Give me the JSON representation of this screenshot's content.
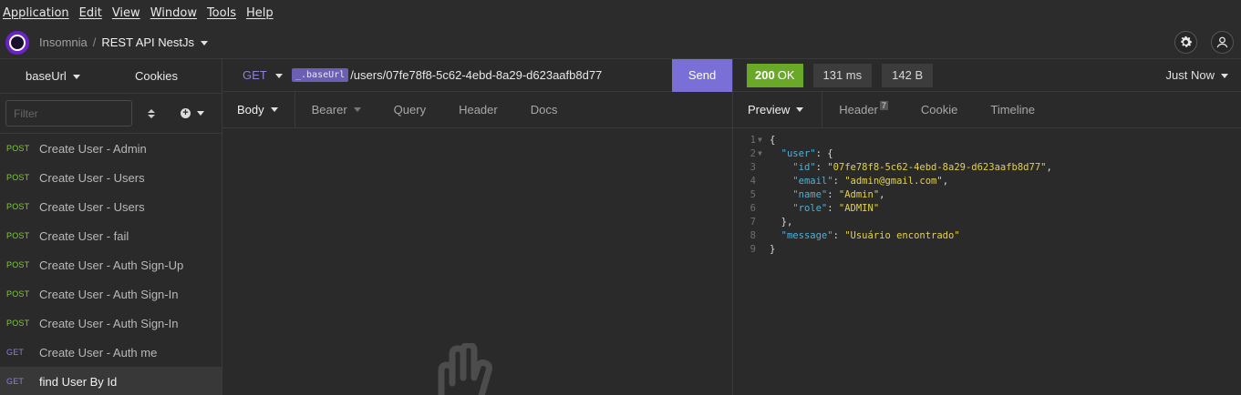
{
  "menu": [
    "Application",
    "Edit",
    "View",
    "Window",
    "Tools",
    "Help"
  ],
  "title": {
    "app": "Insomnia",
    "separator": "/",
    "project": "REST API NestJs"
  },
  "sidebar": {
    "environment": "baseUrl",
    "cookies": "Cookies",
    "filter_placeholder": "Filter",
    "requests": [
      {
        "method": "POST",
        "name": "Create User - Admin"
      },
      {
        "method": "POST",
        "name": "Create User - Users"
      },
      {
        "method": "POST",
        "name": "Create User - Users"
      },
      {
        "method": "POST",
        "name": "Create User - fail"
      },
      {
        "method": "POST",
        "name": "Create User - Auth Sign-Up"
      },
      {
        "method": "POST",
        "name": "Create User - Auth Sign-In"
      },
      {
        "method": "POST",
        "name": "Create User - Auth Sign-In"
      },
      {
        "method": "GET",
        "name": "Create User - Auth me"
      },
      {
        "method": "GET",
        "name": "find User By Id",
        "active": true
      }
    ]
  },
  "request": {
    "method": "GET",
    "url_variable": "_.baseUrl",
    "url_path": "/users/07fe78f8-5c62-4ebd-8a29-d623aafb8d77",
    "send_label": "Send",
    "tabs": [
      "Body",
      "Bearer",
      "Query",
      "Header",
      "Docs"
    ]
  },
  "response": {
    "status_code": "200",
    "status_text": "OK",
    "time": "131 ms",
    "size": "142 B",
    "history": "Just Now",
    "tabs": [
      "Preview",
      "Header",
      "Cookie",
      "Timeline"
    ],
    "header_count": "7",
    "lines": [
      {
        "n": "1",
        "fold": "▼",
        "text": "{"
      },
      {
        "n": "2",
        "fold": "▼",
        "indent": 1,
        "key": "\"user\"",
        "rest": ": {"
      },
      {
        "n": "3",
        "indent": 2,
        "key": "\"id\"",
        "value": "\"07fe78f8-5c62-4ebd-8a29-d623aafb8d77\"",
        "tail": ","
      },
      {
        "n": "4",
        "indent": 2,
        "key": "\"email\"",
        "value": "\"admin@gmail.com\"",
        "tail": ","
      },
      {
        "n": "5",
        "indent": 2,
        "key": "\"name\"",
        "value": "\"Admin\"",
        "tail": ","
      },
      {
        "n": "6",
        "indent": 2,
        "key": "\"role\"",
        "value": "\"ADMIN\"",
        "tail": ""
      },
      {
        "n": "7",
        "indent": 1,
        "text": "},"
      },
      {
        "n": "8",
        "indent": 1,
        "key": "\"message\"",
        "value": "\"Usuário encontrado\"",
        "tail": ""
      },
      {
        "n": "9",
        "text": "}"
      }
    ]
  },
  "colors": {
    "post": "#7bcf2b",
    "get": "#8a80d8",
    "send": "#7a6fd6",
    "ok": "#6aa928",
    "json_key": "#4fb0d8",
    "json_string": "#e2d24a"
  }
}
